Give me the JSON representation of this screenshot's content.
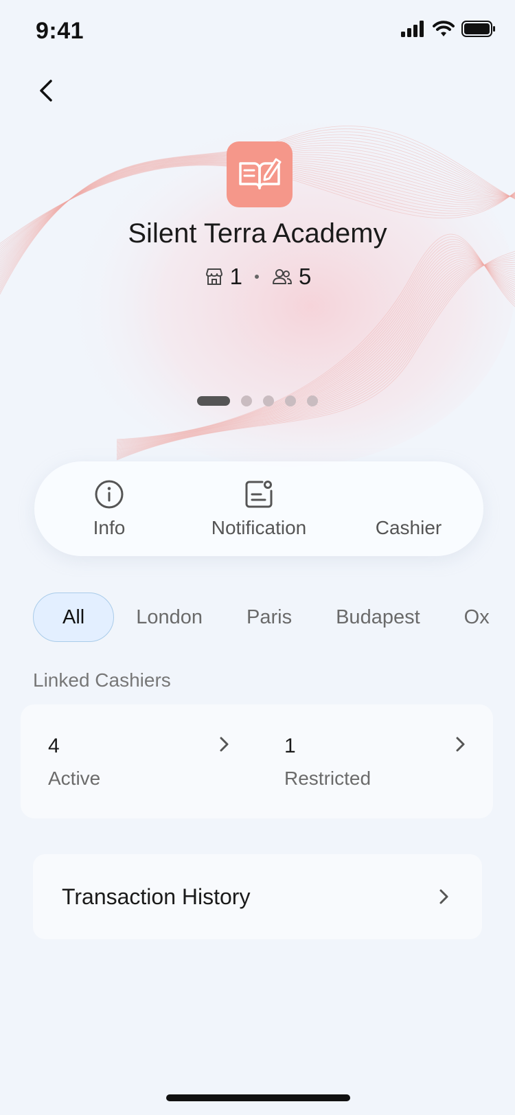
{
  "status_bar": {
    "time": "9:41",
    "icons": [
      "signal-icon",
      "wifi-icon",
      "battery-icon"
    ]
  },
  "nav": {
    "back_icon": "chevron-left-icon"
  },
  "store": {
    "name": "Silent Terra Academy",
    "logo_icon": "open-book-pen-icon",
    "logo_color": "#f5978a",
    "store_count": "1",
    "member_count": "5",
    "store_icon": "shop-icon",
    "member_icon": "users-icon"
  },
  "pager": {
    "count": 5,
    "active_index": 0
  },
  "actions": [
    {
      "label": "Info",
      "icon": "info-icon"
    },
    {
      "label": "Notification",
      "icon": "notification-icon"
    },
    {
      "label": "Cashier",
      "icon": "plus-icon"
    }
  ],
  "filters": [
    {
      "label": "All",
      "active": true
    },
    {
      "label": "London",
      "active": false
    },
    {
      "label": "Paris",
      "active": false
    },
    {
      "label": "Budapest",
      "active": false
    },
    {
      "label": "Ox",
      "active": false
    }
  ],
  "linked_cashiers": {
    "label": "Linked Cashiers",
    "active": {
      "count": "4",
      "label": "Active"
    },
    "restricted": {
      "count": "1",
      "label": "Restricted"
    }
  },
  "transaction_history": {
    "label": "Transaction History"
  },
  "colors": {
    "accent": "#1aa0d8",
    "chip_active_bg": "#e3efff",
    "background": "#f1f5fb"
  }
}
